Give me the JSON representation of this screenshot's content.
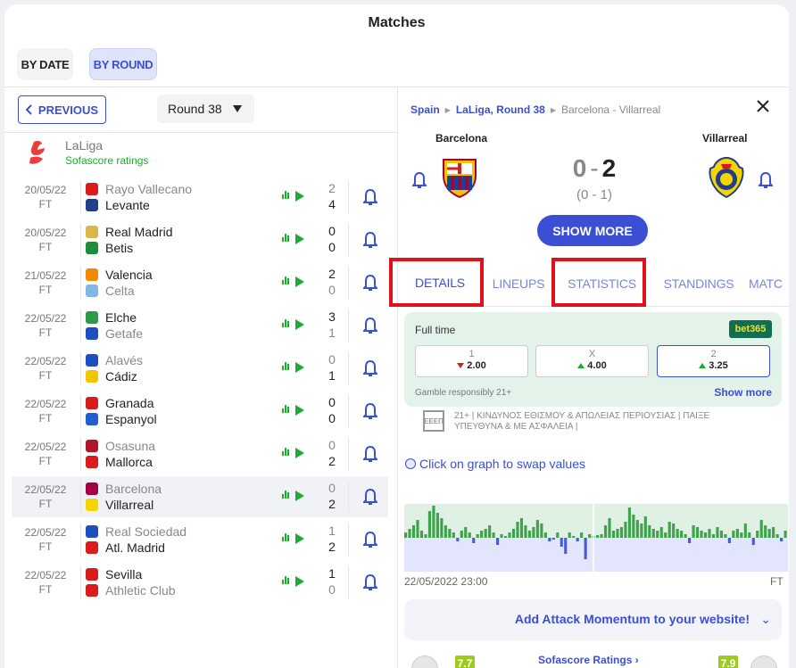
{
  "page": {
    "title": "Matches"
  },
  "modes": {
    "by_date": "BY DATE",
    "by_round": "BY ROUND"
  },
  "nav": {
    "previous": "PREVIOUS",
    "round": "Round 38"
  },
  "league": {
    "name": "LaLiga",
    "sub": "Sofascore ratings"
  },
  "matches": [
    {
      "date": "20/05/22",
      "status": "FT",
      "home": "Rayo Vallecano",
      "away": "Levante",
      "home_score": "2",
      "away_score": "4",
      "winner": "away",
      "home_color": "#d81b1b",
      "away_color": "#1f3f8a"
    },
    {
      "date": "20/05/22",
      "status": "FT",
      "home": "Real Madrid",
      "away": "Betis",
      "home_score": "0",
      "away_score": "0",
      "winner": "none",
      "home_color": "#d8b84a",
      "away_color": "#1d8c3c"
    },
    {
      "date": "21/05/22",
      "status": "FT",
      "home": "Valencia",
      "away": "Celta",
      "home_score": "2",
      "away_score": "0",
      "winner": "home",
      "home_color": "#f18a00",
      "away_color": "#7fb8e6"
    },
    {
      "date": "22/05/22",
      "status": "FT",
      "home": "Elche",
      "away": "Getafe",
      "home_score": "3",
      "away_score": "1",
      "winner": "home",
      "home_color": "#2f9a4a",
      "away_color": "#1f4fbf"
    },
    {
      "date": "22/05/22",
      "status": "FT",
      "home": "Alavés",
      "away": "Cádiz",
      "home_score": "0",
      "away_score": "1",
      "winner": "away",
      "home_color": "#1f4fbf",
      "away_color": "#f2c500"
    },
    {
      "date": "22/05/22",
      "status": "FT",
      "home": "Granada",
      "away": "Espanyol",
      "home_score": "0",
      "away_score": "0",
      "winner": "none",
      "home_color": "#d81b1b",
      "away_color": "#1f5fcf"
    },
    {
      "date": "22/05/22",
      "status": "FT",
      "home": "Osasuna",
      "away": "Mallorca",
      "home_score": "0",
      "away_score": "2",
      "winner": "away",
      "home_color": "#b0162a",
      "away_color": "#d81b1b"
    },
    {
      "date": "22/05/22",
      "status": "FT",
      "home": "Barcelona",
      "away": "Villarreal",
      "home_score": "0",
      "away_score": "2",
      "winner": "away",
      "home_color": "#a50044",
      "away_color": "#f5d500"
    },
    {
      "date": "22/05/22",
      "status": "FT",
      "home": "Real Sociedad",
      "away": "Atl. Madrid",
      "home_score": "1",
      "away_score": "2",
      "winner": "away",
      "home_color": "#1f4fbf",
      "away_color": "#d81b1b"
    },
    {
      "date": "22/05/22",
      "status": "FT",
      "home": "Sevilla",
      "away": "Athletic Club",
      "home_score": "1",
      "away_score": "0",
      "winner": "home",
      "home_color": "#d81b1b",
      "away_color": "#d81b1b"
    }
  ],
  "selected_index": 7,
  "detail": {
    "breadcrumb": {
      "country": "Spain",
      "league": "LaLiga, Round 38",
      "match": "Barcelona - Villarreal"
    },
    "home": "Barcelona",
    "away": "Villarreal",
    "home_score": "0",
    "dash": "-",
    "away_score": "2",
    "halftime": "(0 - 1)",
    "show_more": "SHOW MORE",
    "tabs": [
      "DETAILS",
      "LINEUPS",
      "STATISTICS",
      "STANDINGS",
      "MATC"
    ]
  },
  "odds": {
    "title": "Full time",
    "brand": "bet365",
    "options": [
      {
        "label": "1",
        "value": "2.00",
        "trend": "down"
      },
      {
        "label": "X",
        "value": "4.00",
        "trend": "up"
      },
      {
        "label": "2",
        "value": "3.25",
        "trend": "up"
      }
    ],
    "gamble": "Gamble responsibly 21+",
    "show_more": "Show more",
    "eeep": "ΕΕΕΠ",
    "disclaimer": "21+ | ΚΙΝΔΥΝΟΣ ΕΘΙΣΜΟΥ & ΑΠΩΛΕΙΑΣ ΠΕΡΙΟΥΣΙΑΣ | ΠΑΙΞΕ ΥΠΕΥΘΥΝΑ & ΜΕ ΑΣΦΑΛΕΙΑ |"
  },
  "momentum": {
    "swap": "Click on graph to swap values",
    "date": "22/05/2022 23:00",
    "status": "FT",
    "attack": "Add Attack Momentum to your website!",
    "home_color": "#3ea34a",
    "away_color": "#4a5bd8"
  },
  "ratings": {
    "link": "Sofascore Ratings",
    "home_rating": "7.7",
    "away_rating": "7.9"
  }
}
